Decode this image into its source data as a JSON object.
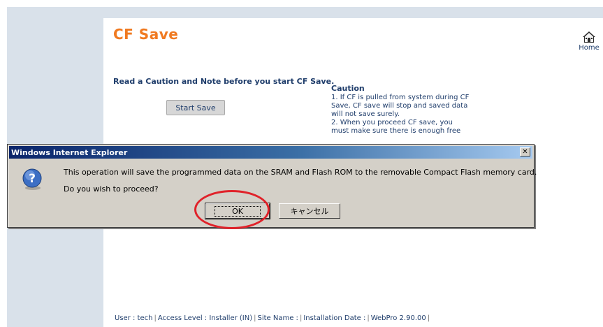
{
  "page": {
    "title": "CF Save",
    "home_label": "Home",
    "intro_text": "Read a Caution and Note before you start CF Save.",
    "start_save_label": "Start Save"
  },
  "caution": {
    "title": "Caution",
    "lines": [
      "1. If CF is pulled from system during CF",
      "Save, CF save will stop and saved data",
      "will not save surely.",
      "2. When you proceed CF save, you",
      "must make sure there is enough free"
    ]
  },
  "dialog": {
    "title": "Windows Internet Explorer",
    "close_glyph": "✕",
    "message": "This operation will save the programmed data on the SRAM and Flash ROM to the removable Compact Flash memory card.",
    "question": "Do you wish to proceed?",
    "ok_label": "OK",
    "cancel_label": "キャンセル"
  },
  "footer": {
    "items": [
      "User : tech",
      "Access Level : Installer (IN)",
      "Site Name :",
      "Installation Date :",
      "WebPro 2.90.00"
    ],
    "trailing_separator": "|"
  },
  "colors": {
    "title": "#f07a21",
    "text": "#1f3d6b",
    "panel": "#d9e1ea",
    "dialog_face": "#d4d0c8",
    "highlight": "#e0222a"
  },
  "icons": {
    "home": "home-icon",
    "question": "question-icon",
    "close": "close-icon"
  }
}
